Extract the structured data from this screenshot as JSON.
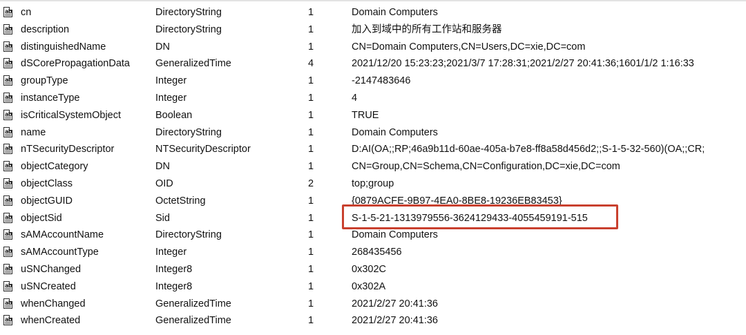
{
  "rows": [
    {
      "name": "cn",
      "syntax": "DirectoryString",
      "count": "1",
      "value": "Domain Computers"
    },
    {
      "name": "description",
      "syntax": "DirectoryString",
      "count": "1",
      "value": "加入到域中的所有工作站和服务器"
    },
    {
      "name": "distinguishedName",
      "syntax": "DN",
      "count": "1",
      "value": "CN=Domain Computers,CN=Users,DC=xie,DC=com"
    },
    {
      "name": "dSCorePropagationData",
      "syntax": "GeneralizedTime",
      "count": "4",
      "value": "2021/12/20 15:23:23;2021/3/7 17:28:31;2021/2/27 20:41:36;1601/1/2 1:16:33"
    },
    {
      "name": "groupType",
      "syntax": "Integer",
      "count": "1",
      "value": "-2147483646"
    },
    {
      "name": "instanceType",
      "syntax": "Integer",
      "count": "1",
      "value": "4"
    },
    {
      "name": "isCriticalSystemObject",
      "syntax": "Boolean",
      "count": "1",
      "value": "TRUE"
    },
    {
      "name": "name",
      "syntax": "DirectoryString",
      "count": "1",
      "value": "Domain Computers"
    },
    {
      "name": "nTSecurityDescriptor",
      "syntax": "NTSecurityDescriptor",
      "count": "1",
      "value": "D:AI(OA;;RP;46a9b11d-60ae-405a-b7e8-ff8a58d456d2;;S-1-5-32-560)(OA;;CR;"
    },
    {
      "name": "objectCategory",
      "syntax": "DN",
      "count": "1",
      "value": "CN=Group,CN=Schema,CN=Configuration,DC=xie,DC=com"
    },
    {
      "name": "objectClass",
      "syntax": "OID",
      "count": "2",
      "value": "top;group"
    },
    {
      "name": "objectGUID",
      "syntax": "OctetString",
      "count": "1",
      "value": "{0879ACFE-9B97-4EA0-8BE8-19236EB83453}"
    },
    {
      "name": "objectSid",
      "syntax": "Sid",
      "count": "1",
      "value": "S-1-5-21-1313979556-3624129433-4055459191-515"
    },
    {
      "name": "sAMAccountName",
      "syntax": "DirectoryString",
      "count": "1",
      "value": "Domain Computers"
    },
    {
      "name": "sAMAccountType",
      "syntax": "Integer",
      "count": "1",
      "value": "268435456"
    },
    {
      "name": "uSNChanged",
      "syntax": "Integer8",
      "count": "1",
      "value": "0x302C"
    },
    {
      "name": "uSNCreated",
      "syntax": "Integer8",
      "count": "1",
      "value": "0x302A"
    },
    {
      "name": "whenChanged",
      "syntax": "GeneralizedTime",
      "count": "1",
      "value": "2021/2/27 20:41:36"
    },
    {
      "name": "whenCreated",
      "syntax": "GeneralizedTime",
      "count": "1",
      "value": "2021/2/27 20:41:36"
    }
  ],
  "highlight_row": "objectSid",
  "colors": {
    "highlight_border": "#c9402e",
    "icon_stroke": "#2a2a2a"
  },
  "icon": "attribute-document-icon"
}
